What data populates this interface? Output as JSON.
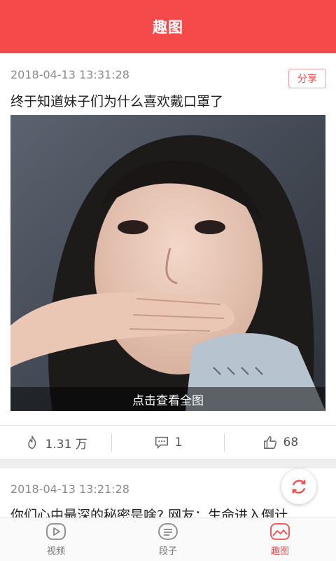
{
  "header": {
    "title": "趣图"
  },
  "posts": [
    {
      "timestamp": "2018-04-13 13:31:28",
      "share_label": "分享",
      "title": "终于知道妹子们为什么喜欢戴口罩了",
      "view_full_label": "点击查看全图",
      "likes": "1.31 万",
      "comments": "1",
      "thumbs_up": "68"
    },
    {
      "timestamp": "2018-04-13 13:21:28",
      "title": "你们心中最深的秘密是啥? 网友：生命进入倒计"
    }
  ],
  "tabs": [
    {
      "label": "视频",
      "icon": "play-icon",
      "active": false
    },
    {
      "label": "段子",
      "icon": "text-lines-icon",
      "active": false
    },
    {
      "label": "趣图",
      "icon": "image-icon",
      "active": true
    }
  ],
  "colors": {
    "brand": "#f44a4a",
    "muted": "#8a8a8a"
  }
}
